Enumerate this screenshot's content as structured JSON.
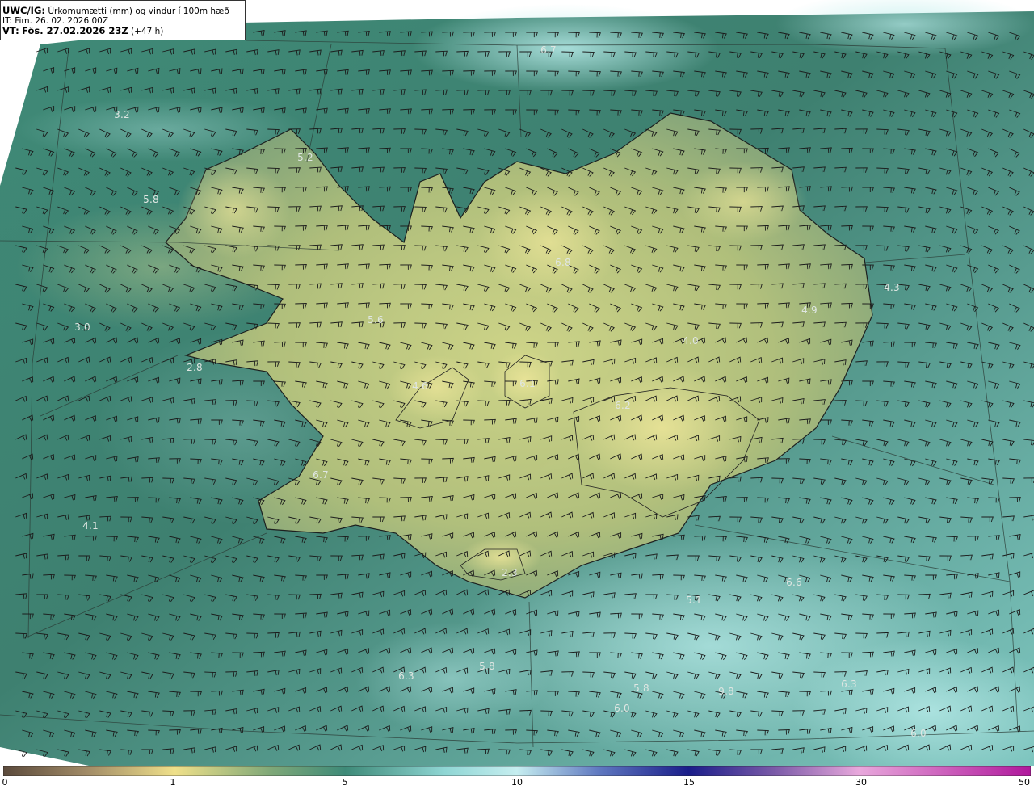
{
  "header": {
    "model": "UWC/IG:",
    "description": "Úrkomumætti (mm) og vindur í 100m hæð",
    "init_time": "IT: Fim. 26. 02. 2026 00Z",
    "valid_prefix": "VT:",
    "valid_time": "Fös. 27.02.2026 23Z",
    "lead": "(+47 h)"
  },
  "map_values": [
    "6.7",
    "3.2",
    "5.8",
    "3.0",
    "2.8",
    "5.6",
    "4.0",
    "4.9",
    "4.3",
    "6.7",
    "4.1",
    "2.3",
    "5.1",
    "6.6",
    "5.8",
    "6.3",
    "6.0",
    "5.8",
    "6.3",
    "9.8",
    "6.8",
    "6.1",
    "6.2",
    "4.6",
    "5.2",
    "6.0"
  ],
  "colorbar": {
    "ticks": [
      "0",
      "1",
      "5",
      "10",
      "15",
      "30",
      "50"
    ],
    "colors": [
      "#5b4a3c",
      "#b89a6a",
      "#efe08a",
      "#8fb07c",
      "#3e8a78",
      "#9de0e0",
      "#b3dcf0",
      "#3a50a8",
      "#1a1d8a",
      "#9a60b0",
      "#e8a0d8",
      "#b0189c"
    ]
  }
}
